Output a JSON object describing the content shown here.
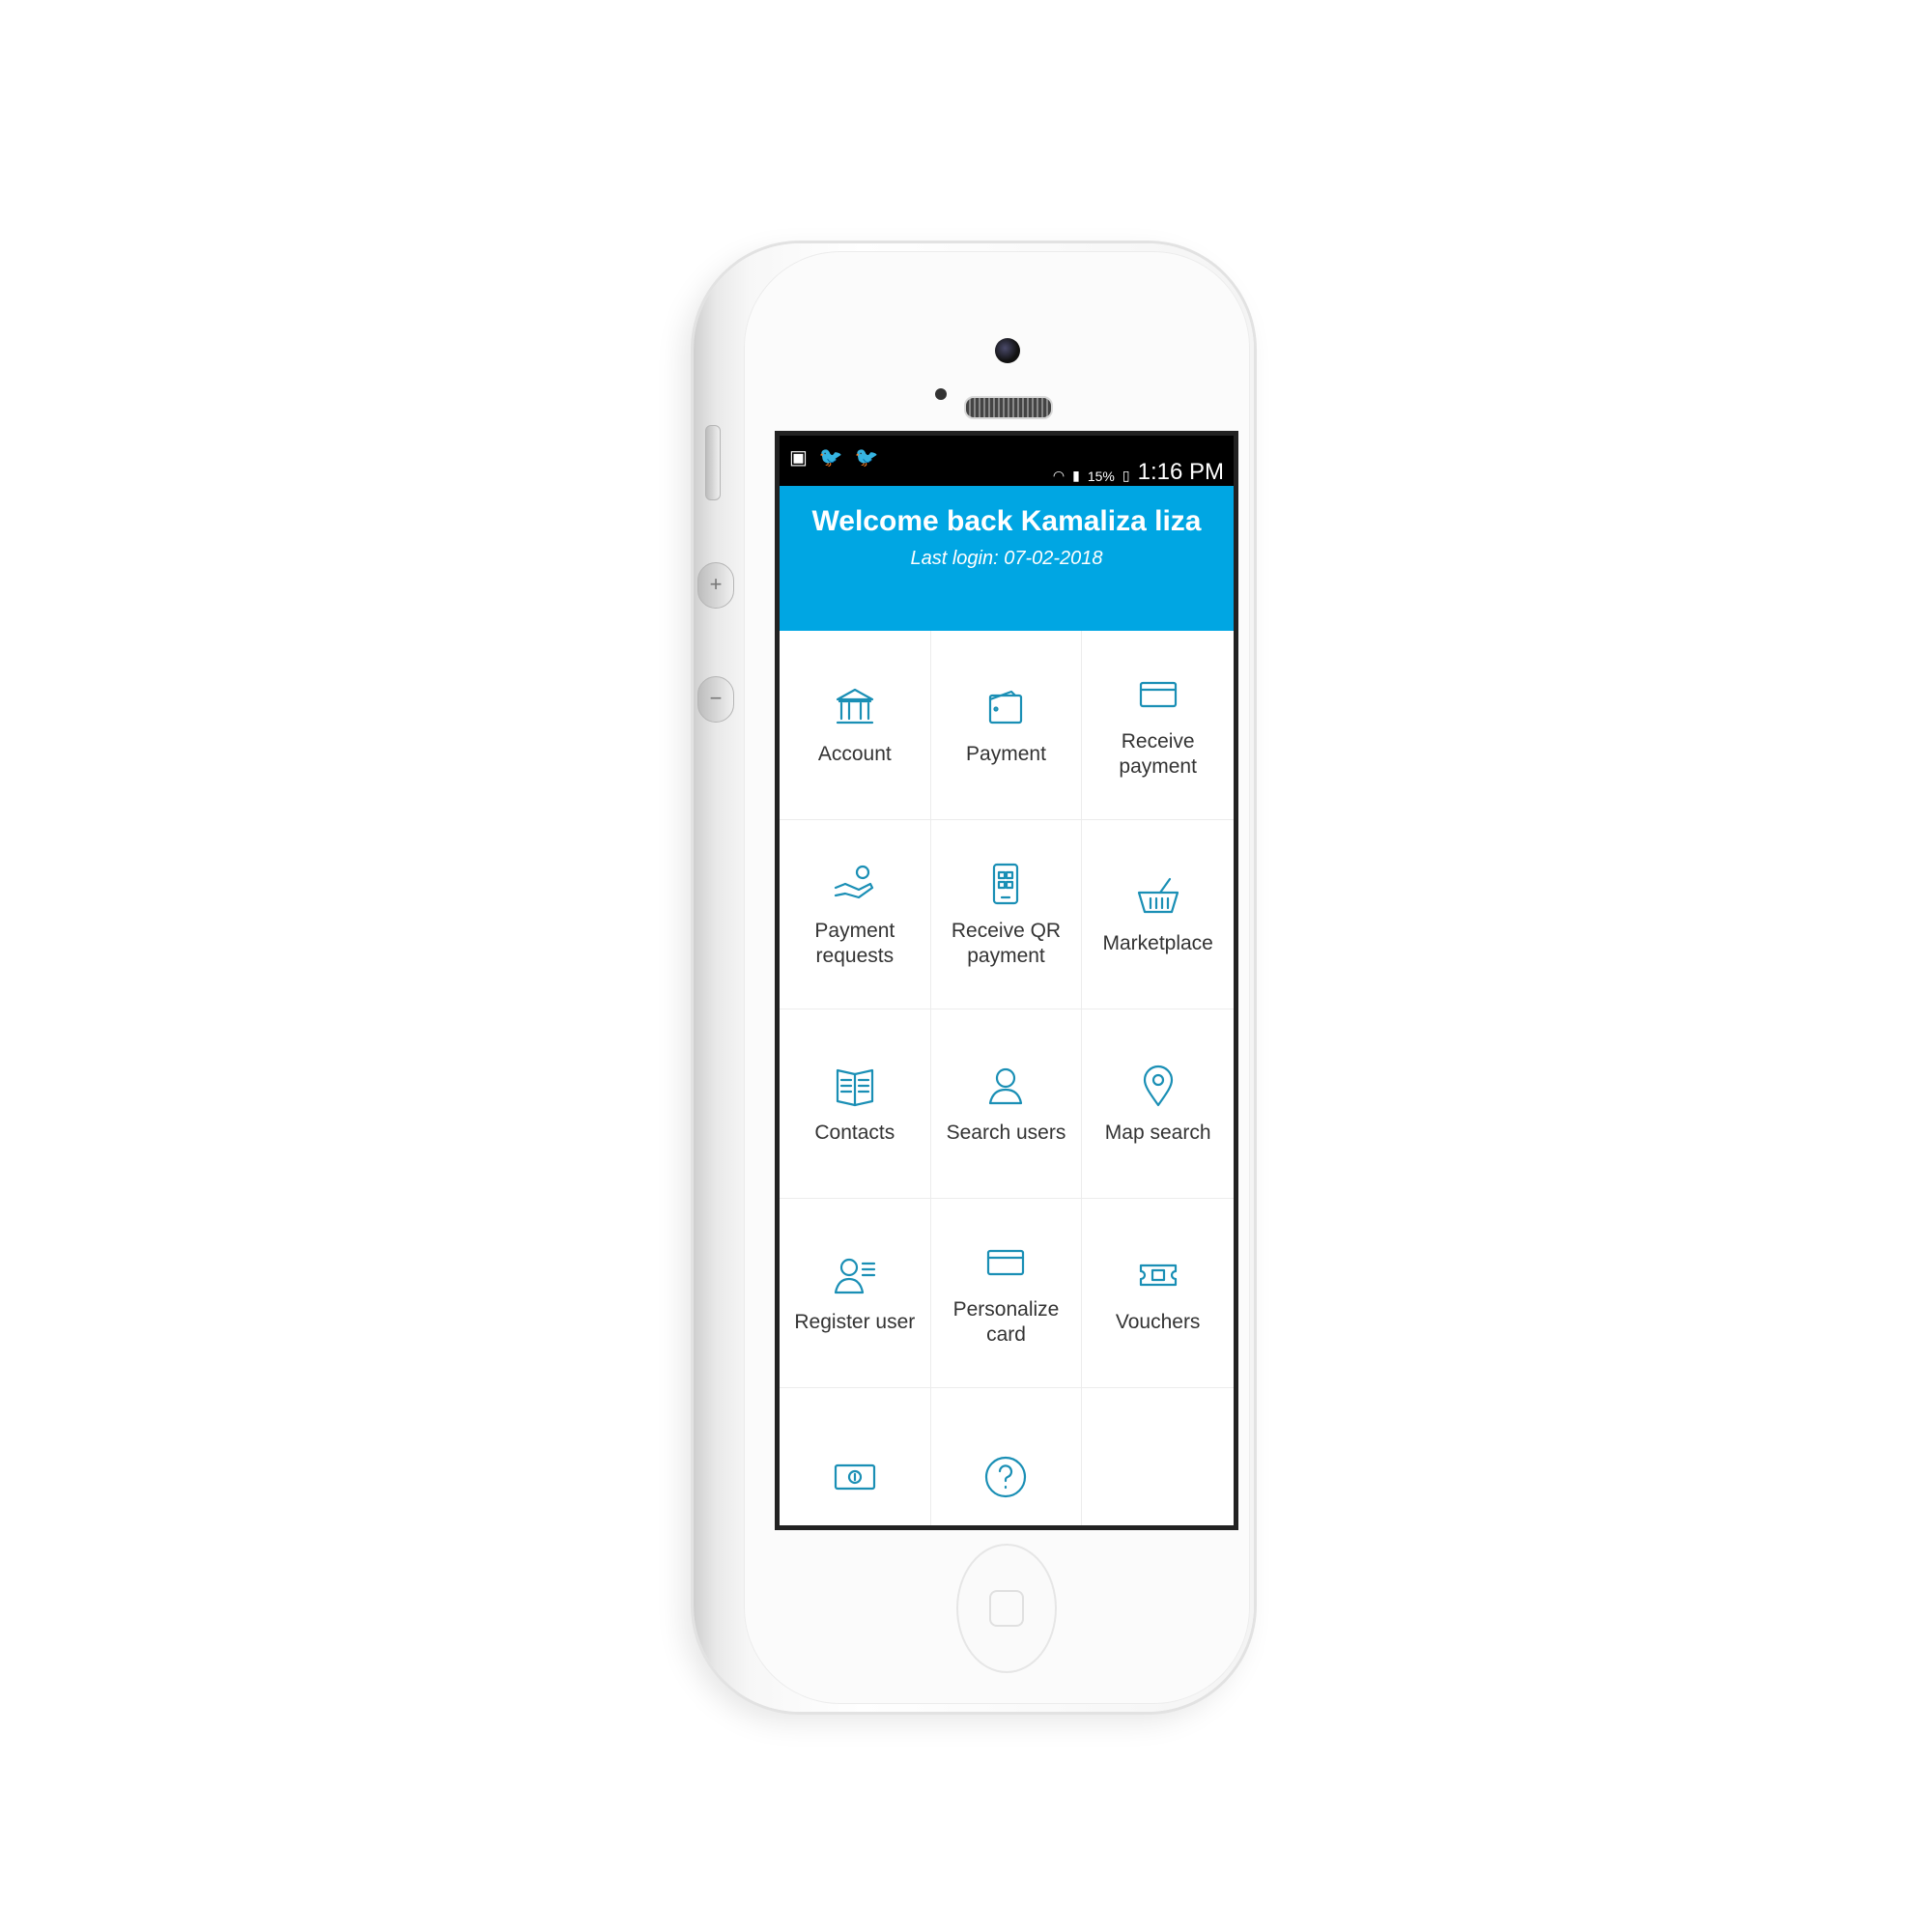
{
  "status_bar": {
    "battery": "15%",
    "time": "1:16 PM",
    "left_icons": [
      "image-icon",
      "twitter-icon",
      "twitter-icon"
    ]
  },
  "header": {
    "title": "Welcome back Kamaliza liza",
    "subtitle": "Last login: 07-02-2018"
  },
  "tiles": [
    {
      "label": "Account",
      "icon": "bank-icon"
    },
    {
      "label": "Payment",
      "icon": "wallet-icon"
    },
    {
      "label": "Receive payment",
      "icon": "card-icon"
    },
    {
      "label": "Payment requests",
      "icon": "hand-coin-icon"
    },
    {
      "label": "Receive QR payment",
      "icon": "qr-phone-icon"
    },
    {
      "label": "Marketplace",
      "icon": "basket-icon"
    },
    {
      "label": "Contacts",
      "icon": "book-icon"
    },
    {
      "label": "Search users",
      "icon": "users-icon"
    },
    {
      "label": "Map search",
      "icon": "map-pin-icon"
    },
    {
      "label": "Register user",
      "icon": "register-user-icon"
    },
    {
      "label": "Personalize card",
      "icon": "card-icon"
    },
    {
      "label": "Vouchers",
      "icon": "voucher-icon"
    },
    {
      "label": "",
      "icon": "banknote-icon"
    },
    {
      "label": "",
      "icon": "help-icon"
    }
  ],
  "colors": {
    "header_bg": "#00a6e3",
    "icon_stroke": "#1a8fb5",
    "status_bar_bg": "#000000"
  }
}
